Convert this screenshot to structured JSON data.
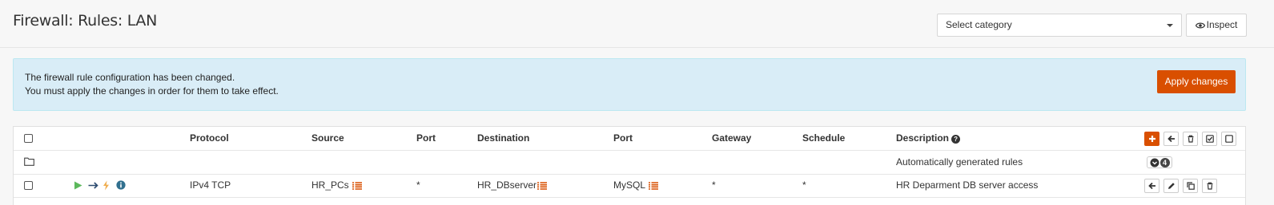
{
  "header": {
    "title": "Firewall: Rules: LAN",
    "category_select": {
      "value": "Select category"
    },
    "inspect_label": "Inspect"
  },
  "alert": {
    "line1": "The firewall rule configuration has been changed.",
    "line2": "You must apply the changes in order for them to take effect.",
    "apply_label": "Apply changes"
  },
  "table": {
    "columns": {
      "protocol": "Protocol",
      "source": "Source",
      "port": "Port",
      "destination": "Destination",
      "dest_port": "Port",
      "gateway": "Gateway",
      "schedule": "Schedule",
      "description": "Description"
    },
    "auto_group": {
      "description": "Automatically generated rules",
      "count": "4"
    },
    "rules": [
      {
        "protocol": "IPv4 TCP",
        "source": "HR_PCs",
        "port": "*",
        "destination": "HR_DBserver",
        "dest_port": "MySQL",
        "gateway": "*",
        "schedule": "*",
        "description": "HR Deparment DB server access"
      }
    ]
  },
  "colors": {
    "accent": "#d94f00",
    "alert_bg": "#d9edf7",
    "pass_green": "#5cb85c",
    "info_blue": "#31708f"
  },
  "icons": {
    "action_pass": "play-icon",
    "direction": "arrow-right-icon",
    "quick": "bolt-icon",
    "info": "info-circle-icon",
    "alias": "list-icon"
  }
}
